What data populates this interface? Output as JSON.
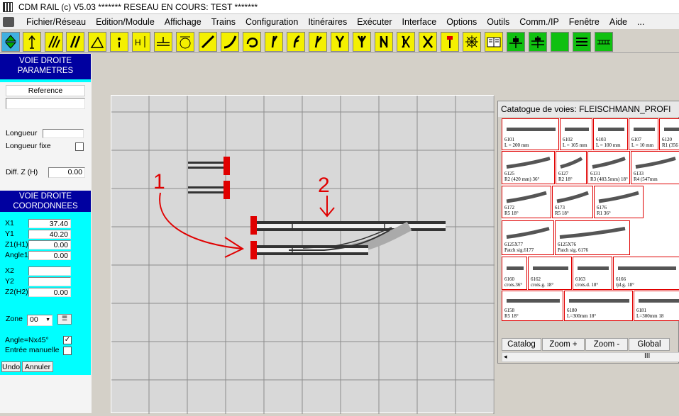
{
  "title": "CDM RAIL (c) V5.03     ******* RESEAU EN COURS: TEST *******",
  "menu": [
    "Fichier/Réseau",
    "Edition/Module",
    "Affichage",
    "Trains",
    "Configuration",
    "Itinéraires",
    "Exécuter",
    "Interface",
    "Options",
    "Outils",
    "Comm./IP",
    "Fenêtre",
    "Aide",
    "..."
  ],
  "toolbar_icons": [
    "up-down-arrows-icon",
    "pointer-icon",
    "track-pair-icon",
    "double-slash-icon",
    "slope-icon",
    "point-icon",
    "height-icon",
    "bridge-icon",
    "turntable-icon",
    "straight-track-icon",
    "curve-track-icon",
    "loop-curve-icon",
    "right-turnout-icon",
    "left-turnout-icon",
    "curved-turnout-icon",
    "y-turnout-icon",
    "three-way-turnout-icon",
    "double-slip-icon",
    "slip-icon",
    "crossing-icon",
    "buffer-stop-icon",
    "turntable-yellow-icon",
    "catalog-book-icon",
    "signal-green-icon",
    "signal-green-2-icon",
    "green-square-icon",
    "layers-icon",
    "ruler-icon"
  ],
  "panel": {
    "header1": [
      "VOIE DROITE",
      "PARAMETRES"
    ],
    "reference_label": "Reference",
    "reference_value": "",
    "longueur_label": "Longueur",
    "longueur_value": "",
    "longueur_fixe_label": "Longueur fixe",
    "diffz_label": "Diff. Z (H)",
    "diffz_value": "0.00",
    "header2": [
      "VOIE DROITE",
      "COORDONNEES"
    ],
    "x1_label": "X1",
    "x1_value": "37.40",
    "y1_label": "Y1",
    "y1_value": "40.20",
    "z1_label": "Z1(H1)",
    "z1_value": "0.00",
    "angle1_label": "Angle1",
    "angle1_value": "0.00",
    "x2_label": "X2",
    "x2_value": "",
    "y2_label": "Y2",
    "y2_value": "",
    "z2_label": "Z2(H2)",
    "z2_value": "0.00",
    "zone_label": "Zone",
    "zone_value": "00",
    "angle_nx45_label": "Angle=Nx45°",
    "angle_nx45_checked": true,
    "entree_label": "Entrée manuelle",
    "entree_checked": false,
    "undo_button": "Undo",
    "cancel_button": "Annuler"
  },
  "annotations": {
    "label1": "1",
    "label2": "2",
    "color": "#e00000"
  },
  "catalog": {
    "title": "Catatogue de voies: FLEISCHMANN_PROFI",
    "items": [
      [
        "6101",
        "L = 200 mm"
      ],
      [
        "6102",
        "L = 105 mm"
      ],
      [
        "6103",
        "L = 100 mm"
      ],
      [
        "6107",
        "L = 10 mm"
      ],
      [
        "6120",
        "R1 (356"
      ],
      [
        "6125",
        "R2 (420 mm) 36°"
      ],
      [
        "6127",
        "R2 18°"
      ],
      [
        "6131",
        "R3 (483.5mm) 18°"
      ],
      [
        "6133",
        "R4 (547mm"
      ],
      [
        "6172",
        "R5 18°"
      ],
      [
        "6173",
        "R5 18°"
      ],
      [
        "6176",
        "R1 36°"
      ],
      [
        "6125X77",
        "Patch sig.6177"
      ],
      [
        "6125X76",
        "Patch sig. 6176"
      ],
      [
        "6160",
        "crois.36°"
      ],
      [
        "6162",
        "crois.g. 18°"
      ],
      [
        "6163",
        "crois.d. 18°"
      ],
      [
        "6166",
        "tjd.g. 18°"
      ],
      [
        "6158",
        "R5 18°"
      ],
      [
        "6180",
        "L=300mm 18°"
      ],
      [
        "6181",
        "L=300mm 18"
      ]
    ],
    "buttons": [
      "Catalog",
      "Zoom +",
      "Zoom -",
      "Global"
    ],
    "scroll_label": "III"
  },
  "colors": {
    "accent_blue": "#0000a0",
    "panel_cyan": "#00ffff",
    "toolbar_yellow": "#f4f000",
    "grid_bg": "#d8d8d8",
    "buffer_red": "#e00000"
  }
}
